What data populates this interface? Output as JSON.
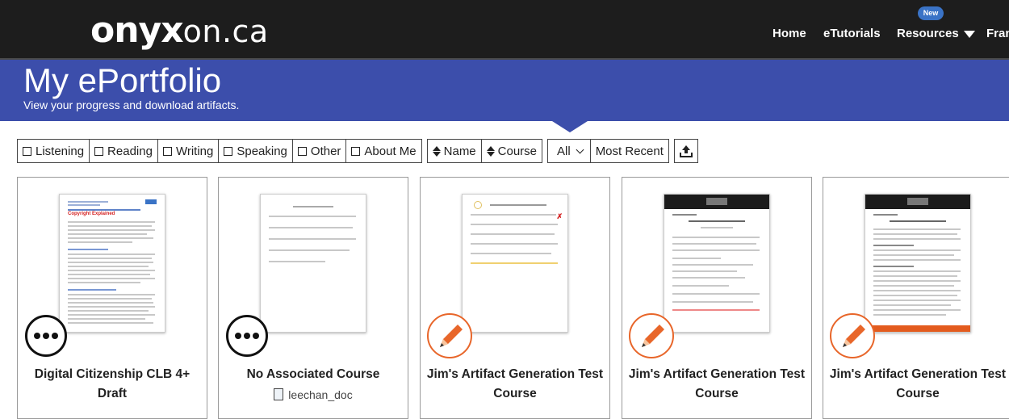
{
  "brand": {
    "logo_main": "onyx",
    "logo_tld": "on.ca"
  },
  "nav": {
    "home": "Home",
    "etutorials": "eTutorials",
    "resources": "Resources",
    "resources_badge": "New",
    "french": "Fran"
  },
  "hero": {
    "title": "My ePortfolio",
    "subtitle": "View your progress and download artifacts."
  },
  "filters": {
    "types": [
      "Listening",
      "Reading",
      "Writing",
      "Speaking",
      "Other",
      "About Me"
    ],
    "sort": [
      "Name",
      "Course"
    ],
    "scope": "All",
    "order": "Most Recent"
  },
  "cards": [
    {
      "title": "Digital Citizenship CLB 4+ Draft",
      "subtitle": "",
      "badge": "more-icon",
      "thumb_heading": "Copyright Explained"
    },
    {
      "title": "No Associated Course",
      "subtitle": "leechan_doc",
      "badge": "more-icon"
    },
    {
      "title": "Jim's Artifact Generation Test Course",
      "subtitle": "",
      "badge": "pencil-icon"
    },
    {
      "title": "Jim's Artifact Generation Test Course",
      "subtitle": "",
      "badge": "pencil-icon"
    },
    {
      "title": "Jim's Artifact Generation Test Course",
      "subtitle": "",
      "badge": "pencil-icon"
    }
  ],
  "colors": {
    "nav_bg": "#1d1d1d",
    "hero_bg": "#3c4eab",
    "accent": "#e8662a",
    "badge_blue": "#3a73c6"
  }
}
